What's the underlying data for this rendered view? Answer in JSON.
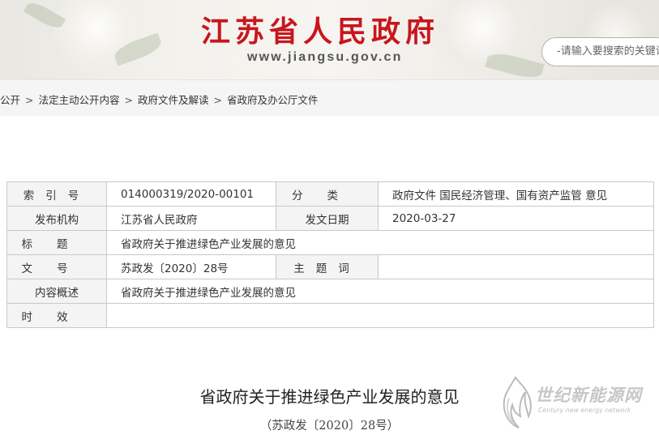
{
  "header": {
    "site_title": "江苏省人民政府",
    "site_url": "www.jiangsu.gov.cn",
    "search_placeholder": "-请输入要搜索的关键词"
  },
  "breadcrumb": {
    "items": [
      "公开",
      "法定主动公开内容",
      "政府文件及解读",
      "省政府及办公厅文件"
    ],
    "separator": ">"
  },
  "info_table": {
    "index_label": "索引号",
    "index_value": "014000319/2020-00101",
    "category_label": "分类",
    "category_value": "政府文件 国民经济管理、国有资产监管 意见",
    "publisher_label": "发布机构",
    "publisher_value": "江苏省人民政府",
    "date_label": "发文日期",
    "date_value": "2020-03-27",
    "title_label": "标题",
    "title_value": "省政府关于推进绿色产业发展的意见",
    "docno_label": "文号",
    "docno_value": "苏政发〔2020〕28号",
    "keywords_label": "主题词",
    "keywords_value": "",
    "summary_label": "内容概述",
    "summary_value": "省政府关于推进绿色产业发展的意见",
    "validity_label": "时效",
    "validity_value": ""
  },
  "article": {
    "title": "省政府关于推进绿色产业发展的意见",
    "doc_number": "（苏政发〔2020〕28号）"
  },
  "watermark": {
    "text": "世纪新能源网",
    "sub": "Century new energy network"
  }
}
